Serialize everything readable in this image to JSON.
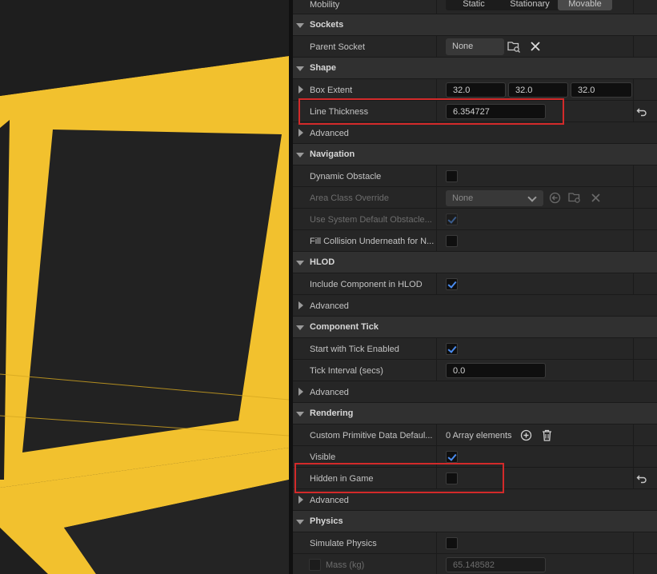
{
  "mobility": {
    "label": "Mobility",
    "options": [
      "Static",
      "Stationary",
      "Movable"
    ],
    "selected": "Movable"
  },
  "sockets": {
    "title": "Sockets",
    "parent_socket_label": "Parent Socket",
    "parent_socket_value": "None"
  },
  "shape": {
    "title": "Shape",
    "box_extent_label": "Box Extent",
    "box_extent": [
      "32.0",
      "32.0",
      "32.0"
    ],
    "line_thickness_label": "Line Thickness",
    "line_thickness": "6.354727",
    "advanced_label": "Advanced"
  },
  "navigation": {
    "title": "Navigation",
    "dynamic_obstacle_label": "Dynamic Obstacle",
    "area_class_label": "Area Class Override",
    "area_class_value": "None",
    "use_system_default_label": "Use System Default Obstacle...",
    "fill_collision_label": "Fill Collision Underneath for N..."
  },
  "hlod": {
    "title": "HLOD",
    "include_label": "Include Component in HLOD",
    "advanced_label": "Advanced"
  },
  "component_tick": {
    "title": "Component Tick",
    "start_tick_label": "Start with Tick Enabled",
    "tick_interval_label": "Tick Interval (secs)",
    "tick_interval": "0.0",
    "advanced_label": "Advanced"
  },
  "rendering": {
    "title": "Rendering",
    "custom_primitive_label": "Custom Primitive Data Defaul...",
    "custom_primitive_value": "0 Array elements",
    "visible_label": "Visible",
    "hidden_label": "Hidden in Game",
    "advanced_label": "Advanced"
  },
  "physics": {
    "title": "Physics",
    "simulate_label": "Simulate Physics",
    "mass_label": "Mass (kg)",
    "mass_value": "65.148582"
  },
  "colors": {
    "highlight": "#d32a2a",
    "check": "#4a8cf0",
    "viewport_yellow": "#f2c12e"
  }
}
